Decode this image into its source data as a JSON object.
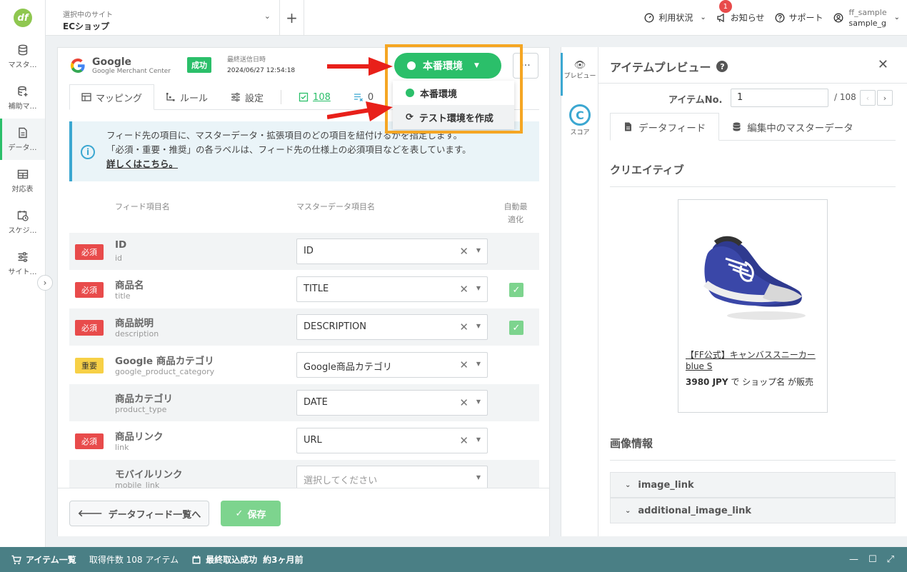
{
  "logo": {
    "text": "df",
    "color": "#8fc750"
  },
  "nav": {
    "items": [
      {
        "label": "マスタ…",
        "icon": "database-icon"
      },
      {
        "label": "補助マ…",
        "icon": "database-plus-icon"
      },
      {
        "label": "データ…",
        "icon": "document-icon",
        "active": true
      },
      {
        "label": "対応表",
        "icon": "table-icon"
      },
      {
        "label": "スケジ…",
        "icon": "calendar-clock-icon"
      },
      {
        "label": "サイト…",
        "icon": "sliders-icon"
      }
    ]
  },
  "header": {
    "site_label": "選択中のサイト",
    "site_name": "ECショップ",
    "usage": "利用状況",
    "news": "お知らせ",
    "news_count": "1",
    "support": "サポート",
    "user_id": "ff_sample",
    "user_name": "sample_g"
  },
  "feed": {
    "name": "Google",
    "sub": "Google Merchant Center",
    "status": "成功",
    "last_sent_label": "最終送信日時",
    "last_sent": "2024/06/27 12:54:18",
    "env_button": "本番環境",
    "env_menu": [
      "本番環境",
      "テスト環境を作成"
    ]
  },
  "tabs": {
    "mapping": "マッピング",
    "rules": "ルール",
    "settings": "設定",
    "count": "108",
    "fx": "0"
  },
  "info": {
    "line1": "フィード先の項目に、マスターデータ・拡張項目のどの項目を紐付けるかを指定します。",
    "line2": "「必須・重要・推奨」の各ラベルは、フィード先の仕様上の必須項目などを表しています。",
    "link": "詳しくはこちら。"
  },
  "table": {
    "col_feed": "フィード項目名",
    "col_master": "マスターデータ項目名",
    "col_auto": "自動最適化",
    "rows": [
      {
        "req": "必須",
        "req_color": "red",
        "name": "ID",
        "key": "id",
        "value": "ID",
        "auto": false
      },
      {
        "req": "必須",
        "req_color": "red",
        "name": "商品名",
        "key": "title",
        "value": "TITLE",
        "auto": true
      },
      {
        "req": "必須",
        "req_color": "red",
        "name": "商品説明",
        "key": "description",
        "value": "DESCRIPTION",
        "auto": true
      },
      {
        "req": "重要",
        "req_color": "yellow",
        "name": "Google 商品カテゴリ",
        "key": "google_product_category",
        "value": "Google商品カテゴリ",
        "auto": false
      },
      {
        "req": "",
        "req_color": "",
        "name": "商品カテゴリ",
        "key": "product_type",
        "value": "DATE",
        "auto": false
      },
      {
        "req": "必須",
        "req_color": "red",
        "name": "商品リンク",
        "key": "link",
        "value": "URL",
        "auto": false
      },
      {
        "req": "",
        "req_color": "",
        "name": "モバイルリンク",
        "key": "mobile_link",
        "value": "",
        "placeholder": "選択してください",
        "auto": false
      }
    ]
  },
  "footer": {
    "back": "データフィード一覧へ",
    "save": "保存"
  },
  "side": {
    "preview": "プレビュー",
    "score": "スコア",
    "score_letter": "C"
  },
  "preview": {
    "title": "アイテムプレビュー",
    "item_no_label": "アイテムNo.",
    "item_no": "1",
    "total": "/ 108",
    "tab_feed": "データフィード",
    "tab_master": "編集中のマスターデータ",
    "creative": "クリエイティブ",
    "product_title": "【FF公式】キャンバススニーカー blue S",
    "price": "3980 JPY",
    "price_mid": " で ",
    "shop": "ショップ名",
    "price_tail": " が販売",
    "image_info": "画像情報",
    "acc1": "image_link",
    "acc2": "additional_image_link"
  },
  "bottom": {
    "items_label": "アイテム一覧",
    "count_text": "取得件数 108 アイテム",
    "last_import_label": "最終取込成功",
    "last_import": "約3ヶ月前"
  }
}
